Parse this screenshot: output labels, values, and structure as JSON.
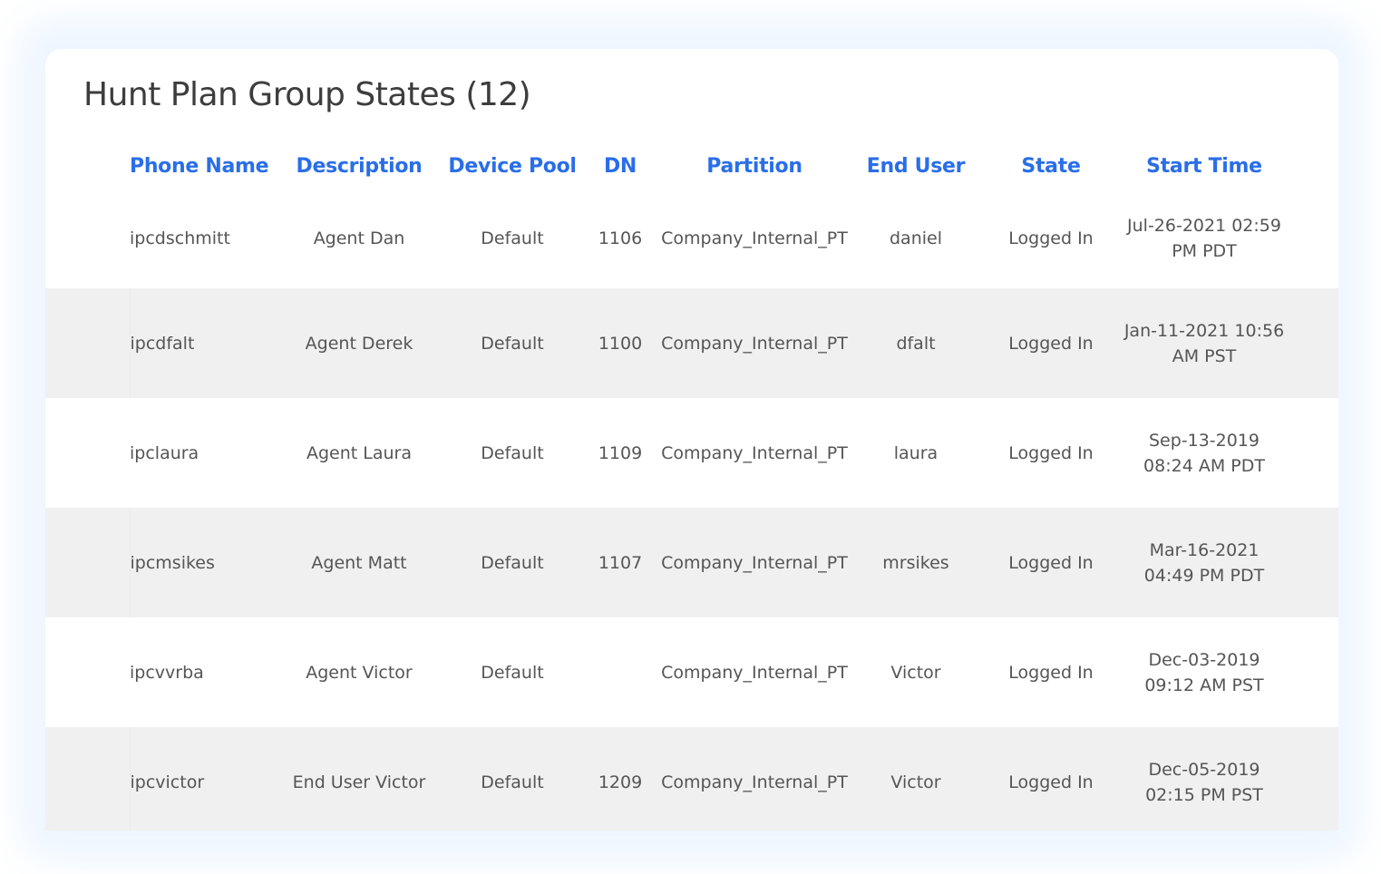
{
  "panel": {
    "title": "Hunt Plan Group States (12)"
  },
  "table": {
    "columns": [
      "Phone Name",
      "Description",
      "Device Pool",
      "DN",
      "Partition",
      "End User",
      "State",
      "Start Time"
    ],
    "rows": [
      {
        "phone_name": "ipcdschmitt",
        "description": "Agent Dan",
        "device_pool": "Default",
        "dn": "1106",
        "partition": "Company_Internal_PT",
        "end_user": "daniel",
        "state": "Logged In",
        "start_time": "Jul-26-2021 02:59 PM PDT"
      },
      {
        "phone_name": "ipcdfalt",
        "description": "Agent Derek",
        "device_pool": "Default",
        "dn": "1100",
        "partition": "Company_Internal_PT",
        "end_user": "dfalt",
        "state": "Logged In",
        "start_time": "Jan-11-2021 10:56 AM PST"
      },
      {
        "phone_name": "ipclaura",
        "description": "Agent Laura",
        "device_pool": "Default",
        "dn": "1109",
        "partition": "Company_Internal_PT",
        "end_user": "laura",
        "state": "Logged In",
        "start_time": "Sep-13-2019 08:24 AM PDT"
      },
      {
        "phone_name": "ipcmsikes",
        "description": "Agent Matt",
        "device_pool": "Default",
        "dn": "1107",
        "partition": "Company_Internal_PT",
        "end_user": "mrsikes",
        "state": "Logged In",
        "start_time": "Mar-16-2021 04:49 PM PDT"
      },
      {
        "phone_name": "ipcvvrba",
        "description": "Agent Victor",
        "device_pool": "Default",
        "dn": "",
        "partition": "Company_Internal_PT",
        "end_user": "Victor",
        "state": "Logged In",
        "start_time": "Dec-03-2019 09:12 AM PST"
      },
      {
        "phone_name": "ipcvictor",
        "description": "End User Victor",
        "device_pool": "Default",
        "dn": "1209",
        "partition": "Company_Internal_PT",
        "end_user": "Victor",
        "state": "Logged In",
        "start_time": "Dec-05-2019 02:15 PM PST"
      }
    ]
  }
}
